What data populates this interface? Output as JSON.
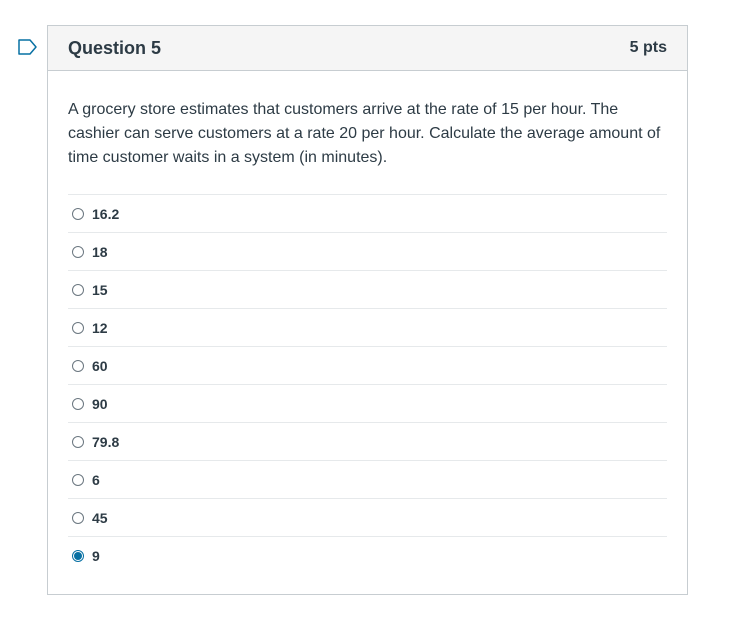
{
  "question": {
    "title": "Question 5",
    "points": "5 pts",
    "text": "A grocery store estimates that customers arrive at the rate of 15 per hour. The cashier can serve customers at a rate 20 per hour. Calculate the average amount of time customer waits in a system (in minutes).",
    "flag_icon": "flag-outline-icon",
    "accent_color": "#0770a3",
    "answers": [
      {
        "label": "16.2",
        "selected": false
      },
      {
        "label": "18",
        "selected": false
      },
      {
        "label": "15",
        "selected": false
      },
      {
        "label": "12",
        "selected": false
      },
      {
        "label": "60",
        "selected": false
      },
      {
        "label": "90",
        "selected": false
      },
      {
        "label": "79.8",
        "selected": false
      },
      {
        "label": "6",
        "selected": false
      },
      {
        "label": "45",
        "selected": false
      },
      {
        "label": "9",
        "selected": true
      }
    ]
  }
}
